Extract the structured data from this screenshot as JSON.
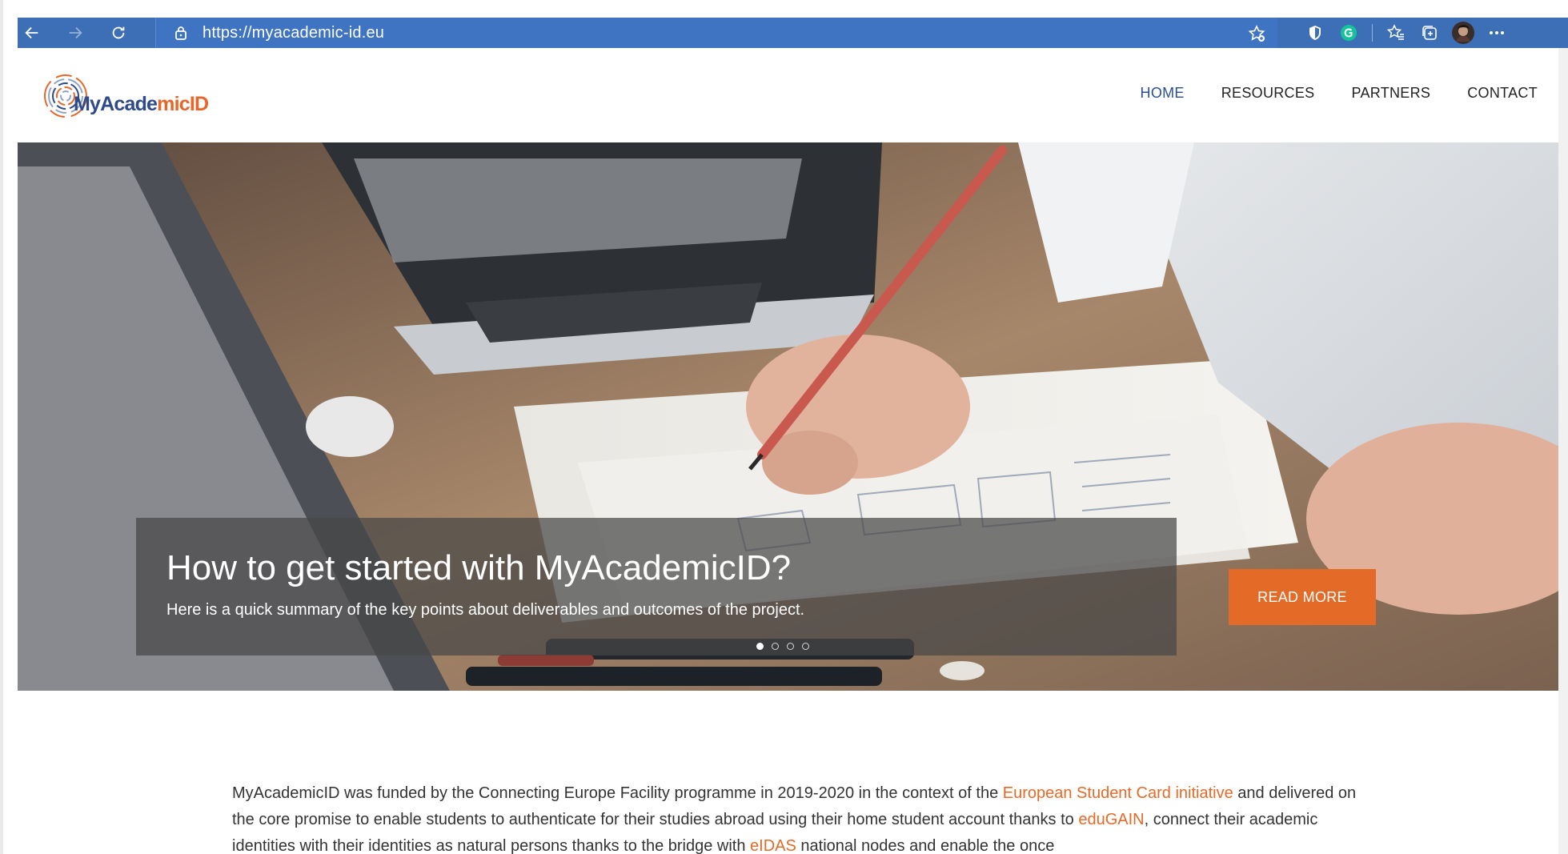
{
  "browser": {
    "url": "https://myacademic-id.eu",
    "icons": [
      "back-arrow-icon",
      "forward-arrow-icon",
      "refresh-icon",
      "lock-icon",
      "add-favorite-icon",
      "shield-extension-icon",
      "grammarly-extension-icon",
      "favorites-icon",
      "collections-icon",
      "profile-avatar",
      "more-options-icon"
    ]
  },
  "site": {
    "logo": {
      "part1": "MyAcade",
      "part2": "mic",
      "part3": "ID"
    },
    "menu": [
      {
        "label": "HOME",
        "active": true
      },
      {
        "label": "RESOURCES",
        "active": false
      },
      {
        "label": "PARTNERS",
        "active": false
      },
      {
        "label": "CONTACT",
        "active": false
      }
    ]
  },
  "hero": {
    "title": "How to get started with MyAcademicID?",
    "subtitle": "Here is a quick summary of the key points about deliverables and outcomes of the project.",
    "button": "READ MORE",
    "slide_count": 4,
    "active_slide": 1
  },
  "intro": {
    "t1": "MyAcademicID was funded by the Connecting Europe Facility programme in 2019-2020 in the context of the ",
    "link1": "European Student Card initiative",
    "t2": " and delivered on the core promise to enable students to authenticate for their studies abroad using their home student account thanks to ",
    "link2": "eduGAIN",
    "t3": ", connect their academic identities with their identities as natural persons thanks to the bridge with ",
    "link3": "eIDAS",
    "t4": " national nodes and enable the once"
  },
  "colors": {
    "browser_bar": "#3d6fb6",
    "accent": "#e46a28",
    "nav_active": "#2b4e8c"
  }
}
